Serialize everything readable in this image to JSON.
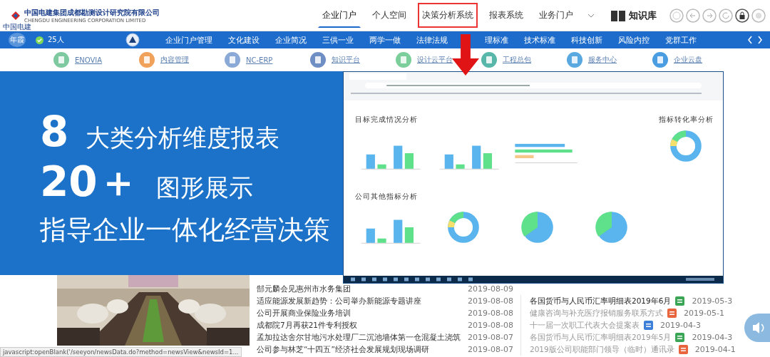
{
  "header": {
    "company_name": "中国电建集团成都勘测设计研究院有限公司",
    "company_name_en": "CHENGDU ENGINEERING CORPORATION LIMITED",
    "logo_caption": "中国电建",
    "tabs": [
      {
        "label": "企业门户",
        "selected": true,
        "highlighted": false
      },
      {
        "label": "个人空间",
        "selected": false,
        "highlighted": false
      },
      {
        "label": "决策分析系统",
        "selected": false,
        "highlighted": true
      },
      {
        "label": "报表系统",
        "selected": false,
        "highlighted": false
      },
      {
        "label": "业务门户",
        "selected": false,
        "highlighted": false
      }
    ],
    "knowledge_base": "知识库"
  },
  "nav": {
    "user_badge": "年霞",
    "online_count": "25人",
    "items": [
      "企业门户管理",
      "文化建设",
      "企业简况",
      "三供一业",
      "两学一做",
      "法律法规",
      "理标准",
      "技术标准",
      "科技创新",
      "风险内控",
      "党群工作"
    ]
  },
  "apps": [
    {
      "label": "ENOVIA",
      "color": "#7fc9a0"
    },
    {
      "label": "内容管理",
      "color": "#f0a15a"
    },
    {
      "label": "NC-ERP",
      "color": "#8aa9d6"
    },
    {
      "label": "知识平台",
      "color": "#6f8fc4"
    },
    {
      "label": "设计云平台",
      "color": "#7ccf9a"
    },
    {
      "label": "工程总包",
      "color": "#58b7a8"
    },
    {
      "label": "服务中心",
      "color": "#5aa8e0"
    },
    {
      "label": "企业云盘",
      "color": "#4a9de0"
    }
  ],
  "banner": {
    "count_1": "8",
    "line_1": "大类分析维度报表",
    "count_2": "20＋",
    "line_2": "图形展示",
    "line_3": "指导企业一体化经营决策"
  },
  "dashboard": {
    "section_1": "目标完成情况分析",
    "section_2": "公司其他指标分析",
    "side_title": "指标转化率分析",
    "charts": [
      {
        "kind": "bar"
      },
      {
        "kind": "bar"
      },
      {
        "kind": "hbar"
      },
      {
        "kind": "donut"
      },
      {
        "kind": "bar"
      },
      {
        "kind": "donut"
      },
      {
        "kind": "pie"
      },
      {
        "kind": "pie"
      }
    ]
  },
  "news": [
    {
      "title": "郜元麟会见惠州市水务集团",
      "date": "2019-08-09"
    },
    {
      "title": "适应能源发展新趋势：公司举办新能源专题讲座",
      "date": "2019-08-08"
    },
    {
      "title": "公司开展商业保险业务培训",
      "date": "2019-08-08"
    },
    {
      "title": "成都院7月再获21件专利授权",
      "date": "2019-08-08"
    },
    {
      "title": "孟加拉达舍尔甘地污水处理厂二沉池墙体第一仓混凝土浇筑",
      "date": "2019-08-07"
    },
    {
      "title": "公司参与林芝“十四五”经济社会发展规划现场调研",
      "date": "2019-08-07"
    }
  ],
  "files": [
    {
      "title": "各国货币与人民币汇率明细表2019年6月",
      "kind": "excel",
      "unread": true,
      "date": "2019-05-3"
    },
    {
      "title": "健康咨询与补充医疗报销服务联系方式",
      "kind": "pdf",
      "unread": false,
      "date": "2019-05-1"
    },
    {
      "title": "十一届一次职工代表大会提案表",
      "kind": "word",
      "unread": false,
      "date": "2019-04-3"
    },
    {
      "title": "各国货币与人民币汇率明细表2019年5月",
      "kind": "excel",
      "unread": false,
      "date": "2019-04-3"
    },
    {
      "title": "2019版公司职能部门领导（临时）通讯录",
      "kind": "pdf",
      "unread": false,
      "date": "2019-04-1"
    }
  ],
  "status_bar": "javascript:openBlank('/seeyon/newsData.do?method=newsView&newsId=1..."
}
